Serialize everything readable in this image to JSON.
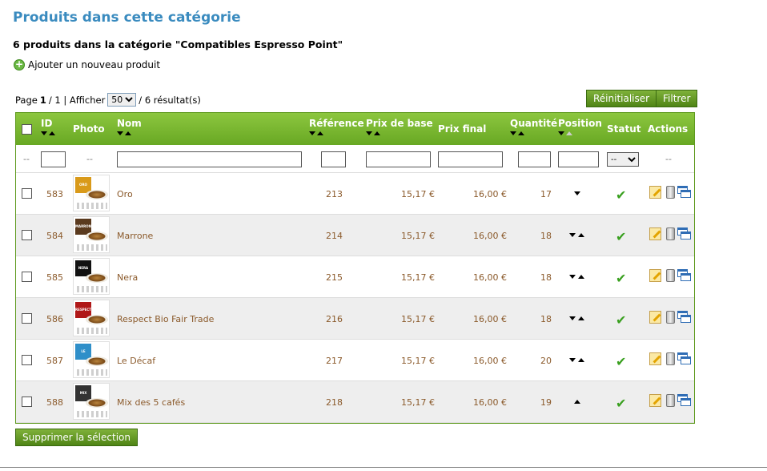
{
  "page": {
    "heading": "Produits dans cette catégorie",
    "subheading": "6 produits dans la catégorie \"Compatibles Espresso Point\"",
    "add_label": "Ajouter un nouveau produit"
  },
  "pager": {
    "page_prefix": "Page",
    "page_current": "1",
    "page_sep": "/ 1 | Afficher",
    "per_page": "50",
    "results": "/ 6 résultat(s)"
  },
  "buttons": {
    "reset": "Réinitialiser",
    "filter": "Filtrer",
    "delete_selection": "Supprimer la sélection"
  },
  "columns": {
    "id": "ID",
    "photo": "Photo",
    "name": "Nom",
    "reference": "Référence",
    "base_price": "Prix de base",
    "final_price": "Prix final",
    "quantity": "Quantité",
    "position": "Position",
    "status": "Statut",
    "actions": "Actions"
  },
  "filters": {
    "dash": "--",
    "status_option": "--"
  },
  "products": [
    {
      "id": "583",
      "label": "ORO",
      "label_color": "#d99a1a",
      "name": "Oro",
      "reference": "213",
      "base_price": "15,17 €",
      "final_price": "16,00 €",
      "quantity": "17",
      "arrows": "down"
    },
    {
      "id": "584",
      "label": "MARRONE",
      "label_color": "#5a3a1e",
      "name": "Marrone",
      "reference": "214",
      "base_price": "15,17 €",
      "final_price": "16,00 €",
      "quantity": "18",
      "arrows": "both"
    },
    {
      "id": "585",
      "label": "NERA",
      "label_color": "#111111",
      "name": "Nera",
      "reference": "215",
      "base_price": "15,17 €",
      "final_price": "16,00 €",
      "quantity": "18",
      "arrows": "both"
    },
    {
      "id": "586",
      "label": "RESPECT",
      "label_color": "#b01818",
      "name": "Respect Bio Fair Trade",
      "reference": "216",
      "base_price": "15,17 €",
      "final_price": "16,00 €",
      "quantity": "18",
      "arrows": "both"
    },
    {
      "id": "587",
      "label": "LE DECAF",
      "label_color": "#2f8fc9",
      "name": "Le Décaf",
      "reference": "217",
      "base_price": "15,17 €",
      "final_price": "16,00 €",
      "quantity": "20",
      "arrows": "both"
    },
    {
      "id": "588",
      "label": "MIX",
      "label_color": "#333333",
      "name": "Mix des 5 cafés",
      "reference": "218",
      "base_price": "15,17 €",
      "final_price": "16,00 €",
      "quantity": "19",
      "arrows": "up"
    }
  ],
  "colors": {
    "heading": "#3a8bbf",
    "header_green": "#7ab52e",
    "row_text": "#8b5a2b",
    "status_check": "#3aa020"
  }
}
